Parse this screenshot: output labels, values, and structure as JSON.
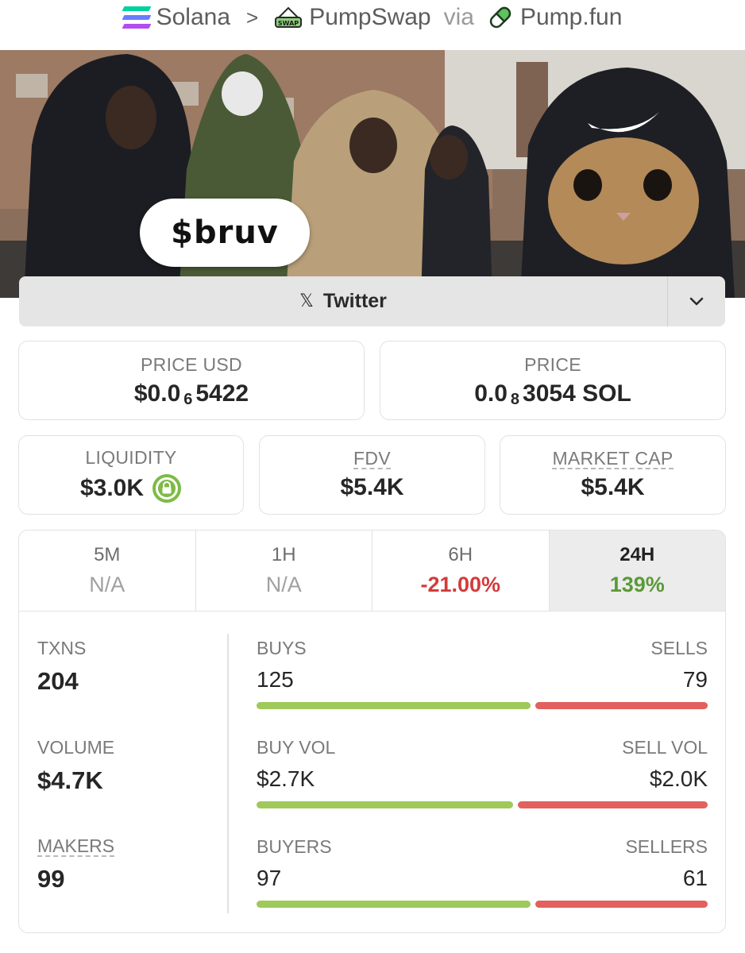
{
  "breadcrumb": {
    "chain": "Solana",
    "separator": ">",
    "dex": "PumpSwap",
    "dex_icon_text": "SWAP",
    "via": "via",
    "platform": "Pump.fun"
  },
  "banner": {
    "ticker": "$bruv"
  },
  "social": {
    "twitter_label": "Twitter",
    "x_glyph": "𝕏"
  },
  "prices": {
    "usd_label": "PRICE USD",
    "usd_prefix": "$0.0",
    "usd_zeros": "6",
    "usd_digits": "5422",
    "native_label": "PRICE",
    "native_prefix": "0.0",
    "native_zeros": "8",
    "native_digits": "3054 SOL"
  },
  "metrics": {
    "liquidity_label": "LIQUIDITY",
    "liquidity_value": "$3.0K",
    "fdv_label": "FDV",
    "fdv_value": "$5.4K",
    "mcap_label": "MARKET CAP",
    "mcap_value": "$5.4K"
  },
  "periods": [
    {
      "label": "5M",
      "value": "N/A",
      "state": "na"
    },
    {
      "label": "1H",
      "value": "N/A",
      "state": "na"
    },
    {
      "label": "6H",
      "value": "-21.00%",
      "state": "negative"
    },
    {
      "label": "24H",
      "value": "139%",
      "state": "positive",
      "active": true
    }
  ],
  "stats": {
    "txns_label": "TXNS",
    "txns_value": "204",
    "volume_label": "VOLUME",
    "volume_value": "$4.7K",
    "makers_label": "MAKERS",
    "makers_value": "99",
    "buys_label": "BUYS",
    "buys_value": "125",
    "sells_label": "SELLS",
    "sells_value": "79",
    "buy_vol_label": "BUY VOL",
    "buy_vol_value": "$2.7K",
    "sell_vol_label": "SELL VOL",
    "sell_vol_value": "$2.0K",
    "buyers_label": "BUYERS",
    "buyers_value": "97",
    "sellers_label": "SELLERS",
    "sellers_value": "61",
    "txns_buy_share": 0.613,
    "vol_buy_share": 0.574,
    "makers_buy_share": 0.614
  },
  "colors": {
    "buy": "#9fc95a",
    "sell": "#e2605d",
    "negative": "#d23b3b",
    "positive": "#5b9a37",
    "lock": "#7dbb45"
  }
}
